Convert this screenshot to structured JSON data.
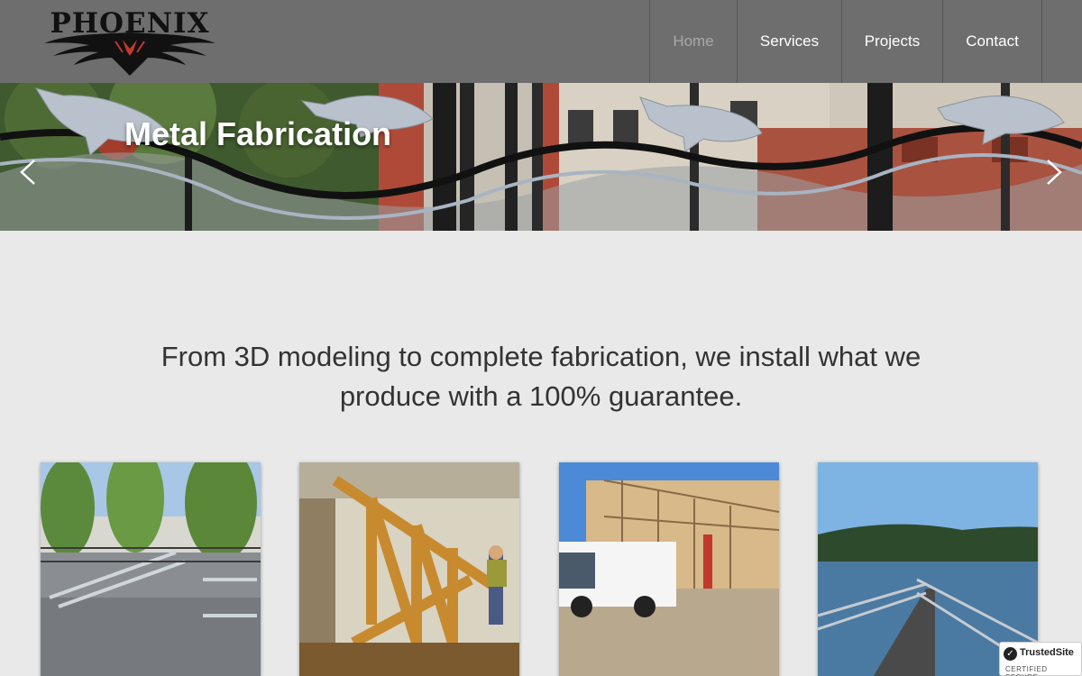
{
  "brand": {
    "name": "PHOENIX"
  },
  "nav": {
    "items": [
      {
        "label": "Home",
        "active": true
      },
      {
        "label": "Services",
        "active": false
      },
      {
        "label": "Projects",
        "active": false
      },
      {
        "label": "Contact",
        "active": false
      }
    ]
  },
  "hero": {
    "title": "Metal Fabrication",
    "prev_icon": "chevron-left-icon",
    "next_icon": "chevron-right-icon"
  },
  "tagline": "From 3D modeling to complete fabrication, we install what we produce with a 100% guarantee.",
  "gallery": [
    {
      "subject": "aluminum-ramp-frames"
    },
    {
      "subject": "timber-truss-workshop"
    },
    {
      "subject": "building-construction-truck"
    },
    {
      "subject": "lakeside-boardwalk-railing"
    }
  ],
  "trust_badge": {
    "name": "TrustedSite",
    "subtitle": "CERTIFIED SECURE"
  },
  "colors": {
    "header_bg": "#6e6e6e",
    "page_bg": "#e9e9e9",
    "nav_text": "#ffffff",
    "nav_active": "#a9a9a9",
    "logo_accent": "#c0392b"
  }
}
